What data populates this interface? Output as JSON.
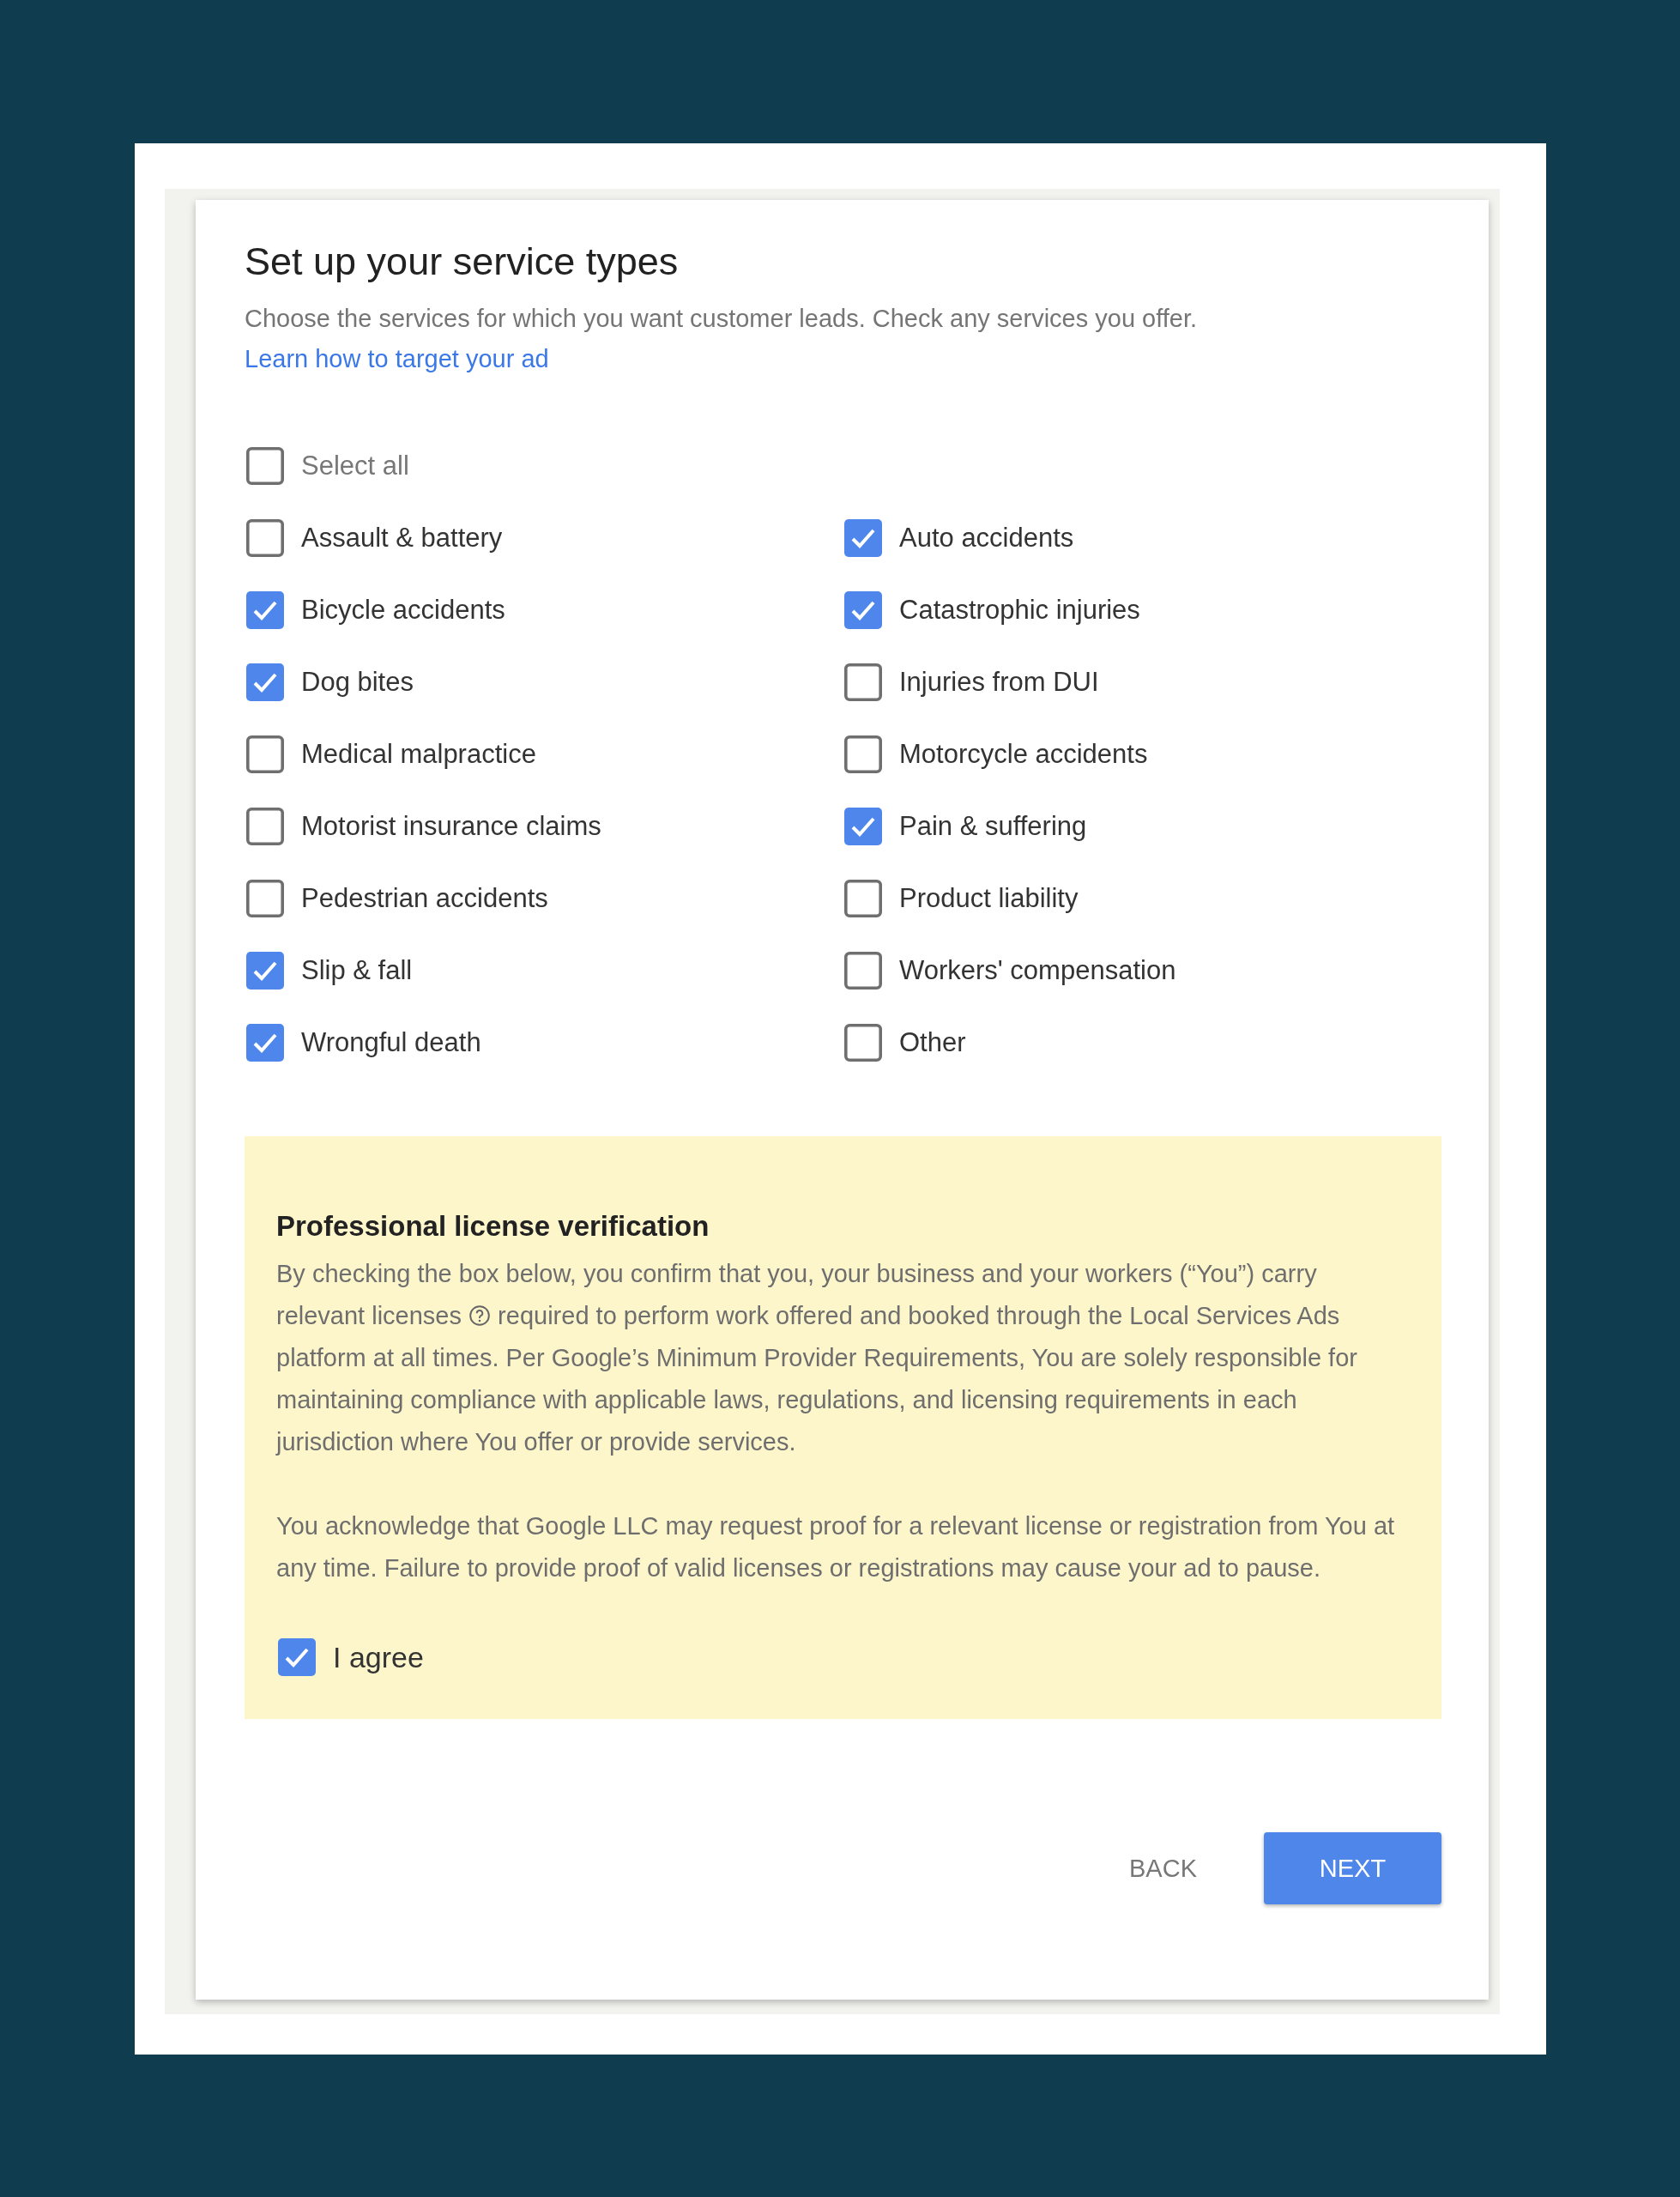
{
  "title": "Set up your service types",
  "intro": {
    "text": "Choose the services for which you want customer leads. Check any services you offer.",
    "link": "Learn how to target your ad"
  },
  "select_all": {
    "label": "Select all",
    "checked": false
  },
  "services": [
    {
      "label": "Assault & battery",
      "checked": false
    },
    {
      "label": "Auto accidents",
      "checked": true
    },
    {
      "label": "Bicycle accidents",
      "checked": true
    },
    {
      "label": "Catastrophic injuries",
      "checked": true
    },
    {
      "label": "Dog bites",
      "checked": true
    },
    {
      "label": "Injuries from DUI",
      "checked": false
    },
    {
      "label": "Medical malpractice",
      "checked": false
    },
    {
      "label": "Motorcycle accidents",
      "checked": false
    },
    {
      "label": "Motorist insurance claims",
      "checked": false
    },
    {
      "label": "Pain & suffering",
      "checked": true
    },
    {
      "label": "Pedestrian accidents",
      "checked": false
    },
    {
      "label": "Product liability",
      "checked": false
    },
    {
      "label": "Slip & fall",
      "checked": true
    },
    {
      "label": "Workers' compensation",
      "checked": false
    },
    {
      "label": "Wrongful death",
      "checked": true
    },
    {
      "label": "Other",
      "checked": false
    }
  ],
  "license": {
    "heading": "Professional license verification",
    "paragraphs": [
      {
        "before_icon": "By checking the box below, you confirm that you, your business and your workers (“You”) carry relevant licenses",
        "after_icon": "required to perform work offered and booked through the Local Services Ads platform at all times. Per Google’s Minimum Provider Requirements, You are solely responsible for maintaining compliance with applicable laws, regulations, and licensing requirements in each jurisdiction where You offer or provide services."
      },
      {
        "before_icon": "You acknowledge that Google LLC may request proof for a relevant license or registration from You at any time. Failure to provide proof of valid licenses or registrations may cause your ad to pause."
      }
    ],
    "agree": {
      "label": "I agree",
      "checked": true
    }
  },
  "buttons": [
    {
      "label": "BACK",
      "kind": "text"
    },
    {
      "label": "NEXT",
      "kind": "primary"
    }
  ]
}
